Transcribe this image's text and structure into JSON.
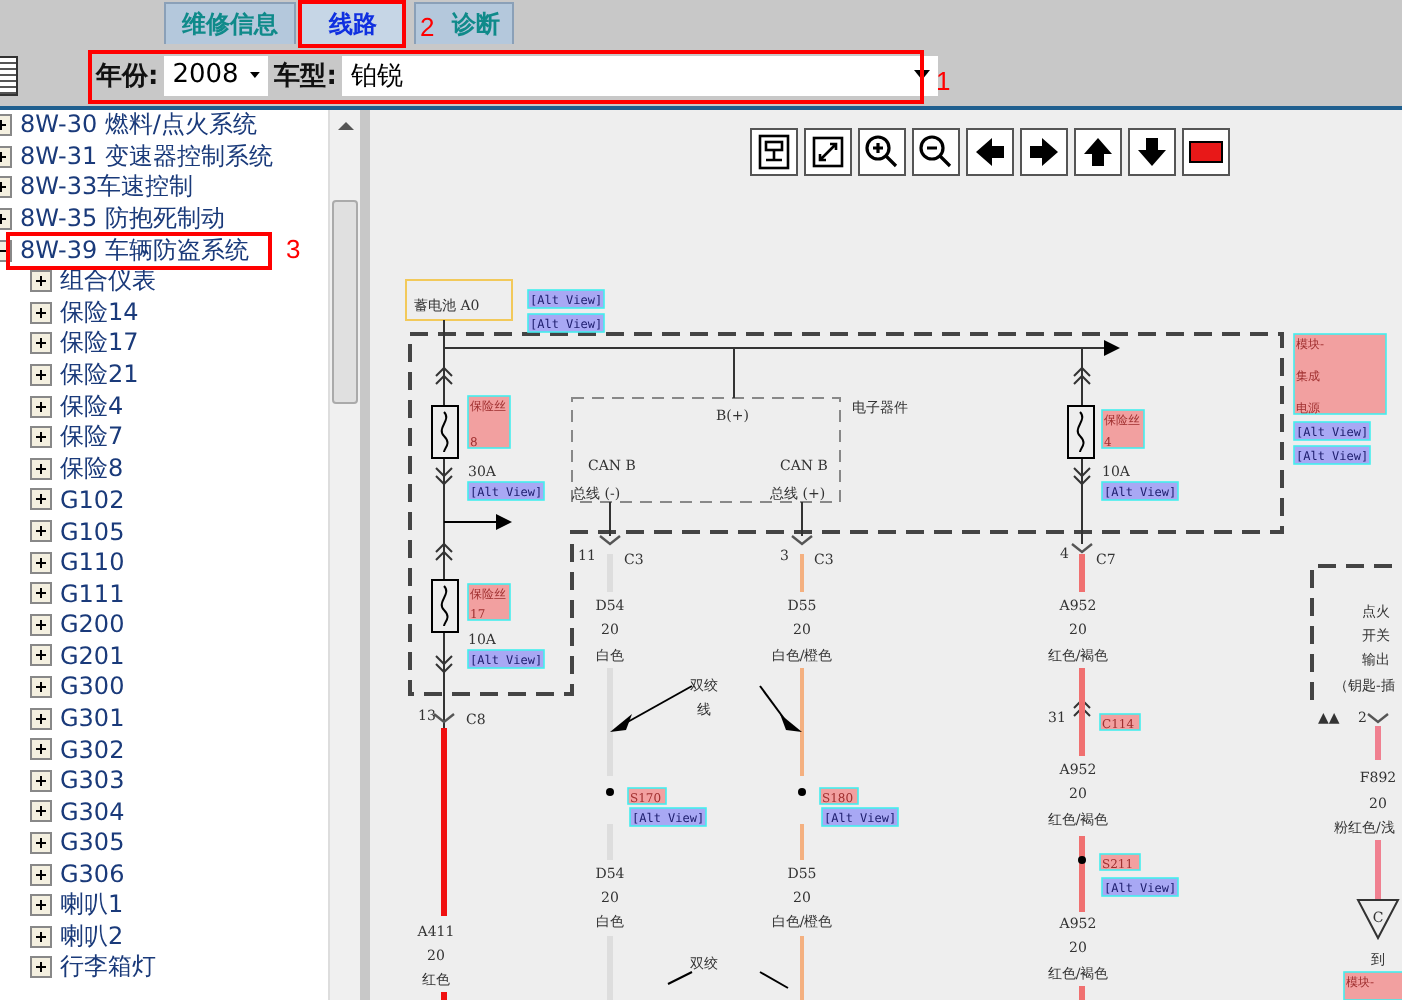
{
  "tabs": [
    {
      "label": "维修信息",
      "selected": false
    },
    {
      "label": "线路",
      "selected": true
    },
    {
      "label": "诊断",
      "selected": false
    }
  ],
  "filters": {
    "year_label": "年份:",
    "year": "2008",
    "model_label": "车型:",
    "model": "铂锐"
  },
  "tree": [
    {
      "label": "8W-30 燃料/点火系统",
      "expanded": false
    },
    {
      "label": "8W-31 变速器控制系统",
      "expanded": false
    },
    {
      "label": "8W-33车速控制",
      "expanded": false
    },
    {
      "label": "8W-35 防抱死制动",
      "expanded": false
    },
    {
      "label": "8W-39 车辆防盗系统",
      "expanded": true,
      "children": [
        {
          "label": "组合仪表",
          "expanded": false
        },
        {
          "label": "保险14",
          "expanded": false
        },
        {
          "label": "保险17",
          "expanded": false
        },
        {
          "label": "保险21",
          "expanded": false
        },
        {
          "label": "保险4",
          "expanded": false
        },
        {
          "label": "保险7",
          "expanded": false
        },
        {
          "label": "保险8",
          "expanded": false
        },
        {
          "label": "G102",
          "expanded": false
        },
        {
          "label": "G105",
          "expanded": false
        },
        {
          "label": "G110",
          "expanded": false
        },
        {
          "label": "G111",
          "expanded": false
        },
        {
          "label": "G200",
          "expanded": false
        },
        {
          "label": "G201",
          "expanded": false
        },
        {
          "label": "G300",
          "expanded": false
        },
        {
          "label": "G301",
          "expanded": false
        },
        {
          "label": "G302",
          "expanded": false
        },
        {
          "label": "G303",
          "expanded": false
        },
        {
          "label": "G304",
          "expanded": false
        },
        {
          "label": "G305",
          "expanded": false
        },
        {
          "label": "G306",
          "expanded": false
        },
        {
          "label": "喇叭1",
          "expanded": false
        },
        {
          "label": "喇叭2",
          "expanded": false
        },
        {
          "label": "行李箱灯",
          "expanded": false
        }
      ]
    }
  ],
  "diagram": {
    "labels": [
      {
        "kind": "text",
        "text": "蓄电池 A0"
      },
      {
        "kind": "link",
        "text": "[Alt View]"
      },
      {
        "kind": "link",
        "text": "[Alt View]"
      },
      {
        "kind": "tag",
        "lines": [
          "保险丝",
          "8"
        ]
      },
      {
        "kind": "text",
        "text": "B(+)"
      },
      {
        "kind": "text",
        "text": "电子器件"
      },
      {
        "kind": "tag",
        "lines": [
          "保险丝",
          "4"
        ]
      },
      {
        "kind": "tag",
        "lines": [
          "模块-",
          "集成",
          "电源"
        ]
      },
      {
        "kind": "link",
        "text": "[Alt View]"
      },
      {
        "kind": "link",
        "text": "[Alt View]"
      },
      {
        "kind": "text",
        "text": "30A"
      },
      {
        "kind": "text",
        "text": "CAN B"
      },
      {
        "kind": "text",
        "text": "CAN B"
      },
      {
        "kind": "text",
        "text": "10A"
      },
      {
        "kind": "link",
        "text": "[Alt View]"
      },
      {
        "kind": "text",
        "text": "总线 (-)"
      },
      {
        "kind": "text",
        "text": "总线 (+)"
      },
      {
        "kind": "link",
        "text": "[Alt View]"
      },
      {
        "kind": "text",
        "text": "11"
      },
      {
        "kind": "text",
        "text": "C3"
      },
      {
        "kind": "text",
        "text": "3"
      },
      {
        "kind": "text",
        "text": "C3"
      },
      {
        "kind": "text",
        "text": "4"
      },
      {
        "kind": "text",
        "text": "C7"
      },
      {
        "kind": "tag",
        "lines": [
          "保险丝",
          "17"
        ]
      },
      {
        "kind": "text",
        "text": "D54"
      },
      {
        "kind": "text",
        "text": "D55"
      },
      {
        "kind": "text",
        "text": "A952"
      },
      {
        "kind": "text",
        "text": "点火"
      },
      {
        "kind": "text",
        "text": "10A"
      },
      {
        "kind": "text",
        "text": "20"
      },
      {
        "kind": "text",
        "text": "20"
      },
      {
        "kind": "text",
        "text": "20"
      },
      {
        "kind": "text",
        "text": "开关"
      },
      {
        "kind": "link",
        "text": "[Alt View]"
      },
      {
        "kind": "text",
        "text": "白色"
      },
      {
        "kind": "text",
        "text": "白色/橙色"
      },
      {
        "kind": "text",
        "text": "红色/褐色"
      },
      {
        "kind": "text",
        "text": "输出"
      },
      {
        "kind": "text",
        "text": "双绞"
      },
      {
        "kind": "text",
        "text": "（钥匙-插"
      },
      {
        "kind": "text",
        "text": "13"
      },
      {
        "kind": "text",
        "text": "C8"
      },
      {
        "kind": "text",
        "text": "线"
      },
      {
        "kind": "text",
        "text": "31"
      },
      {
        "kind": "tag",
        "lines": [
          "C114"
        ]
      },
      {
        "kind": "text",
        "text": "▲▲"
      },
      {
        "kind": "text",
        "text": "2"
      },
      {
        "kind": "text",
        "text": "A952"
      },
      {
        "kind": "text",
        "text": "F892"
      },
      {
        "kind": "tag",
        "lines": [
          "S170"
        ]
      },
      {
        "kind": "tag",
        "lines": [
          "S180"
        ]
      },
      {
        "kind": "text",
        "text": "20"
      },
      {
        "kind": "text",
        "text": "20"
      },
      {
        "kind": "link",
        "text": "[Alt View]"
      },
      {
        "kind": "link",
        "text": "[Alt View]"
      },
      {
        "kind": "text",
        "text": "红色/褐色"
      },
      {
        "kind": "text",
        "text": "粉红色/浅"
      },
      {
        "kind": "tag",
        "lines": [
          "S211"
        ]
      },
      {
        "kind": "text",
        "text": "D54"
      },
      {
        "kind": "text",
        "text": "D55"
      },
      {
        "kind": "link",
        "text": "[Alt View]"
      },
      {
        "kind": "text",
        "text": "20"
      },
      {
        "kind": "text",
        "text": "20"
      },
      {
        "kind": "text",
        "text": "A411"
      },
      {
        "kind": "text",
        "text": "白色"
      },
      {
        "kind": "text",
        "text": "白色/橙色"
      },
      {
        "kind": "text",
        "text": "A952"
      },
      {
        "kind": "text",
        "text": "C"
      },
      {
        "kind": "text",
        "text": "20"
      },
      {
        "kind": "text",
        "text": "双绞"
      },
      {
        "kind": "text",
        "text": "20"
      },
      {
        "kind": "text",
        "text": "到"
      },
      {
        "kind": "text",
        "text": "红色"
      },
      {
        "kind": "text",
        "text": "红色/褐色"
      },
      {
        "kind": "tag",
        "lines": [
          "模块-"
        ]
      }
    ]
  },
  "annotations": [
    "1",
    "2",
    "3"
  ]
}
